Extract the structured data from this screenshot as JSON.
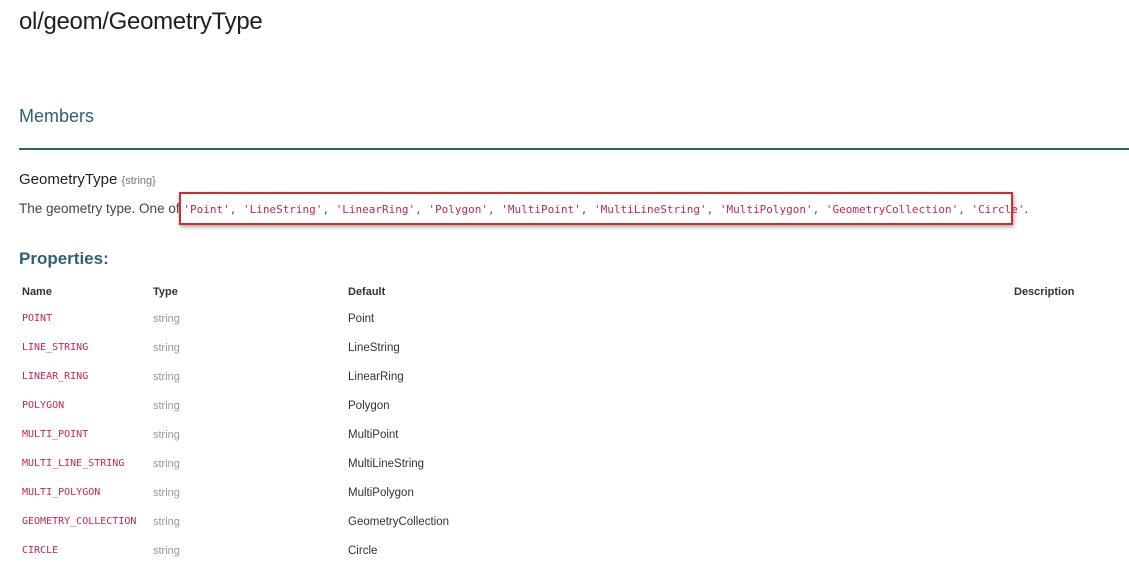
{
  "page": {
    "title": "ol/geom/GeometryType"
  },
  "members": {
    "heading": "Members",
    "name": "GeometryType",
    "type": "{string}",
    "description_prefix": "The geometry type. One of ",
    "values": [
      "'Point'",
      "'LineString'",
      "'LinearRing'",
      "'Polygon'",
      "'MultiPoint'",
      "'MultiLineString'",
      "'MultiPolygon'",
      "'GeometryCollection'",
      "'Circle'"
    ],
    "description_suffix": "."
  },
  "properties": {
    "heading": "Properties:",
    "columns": {
      "name": "Name",
      "type": "Type",
      "default": "Default",
      "description": "Description"
    },
    "rows": [
      {
        "name": "POINT",
        "type": "string",
        "default": "Point",
        "description": ""
      },
      {
        "name": "LINE_STRING",
        "type": "string",
        "default": "LineString",
        "description": ""
      },
      {
        "name": "LINEAR_RING",
        "type": "string",
        "default": "LinearRing",
        "description": ""
      },
      {
        "name": "POLYGON",
        "type": "string",
        "default": "Polygon",
        "description": ""
      },
      {
        "name": "MULTI_POINT",
        "type": "string",
        "default": "MultiPoint",
        "description": ""
      },
      {
        "name": "MULTI_LINE_STRING",
        "type": "string",
        "default": "MultiLineString",
        "description": ""
      },
      {
        "name": "MULTI_POLYGON",
        "type": "string",
        "default": "MultiPolygon",
        "description": ""
      },
      {
        "name": "GEOMETRY_COLLECTION",
        "type": "string",
        "default": "GeometryCollection",
        "description": ""
      },
      {
        "name": "CIRCLE",
        "type": "string",
        "default": "Circle",
        "description": ""
      }
    ]
  },
  "colors": {
    "heading": "#2e6171",
    "code_literal": "#c7254e",
    "highlight_box": "#d42b2b"
  }
}
